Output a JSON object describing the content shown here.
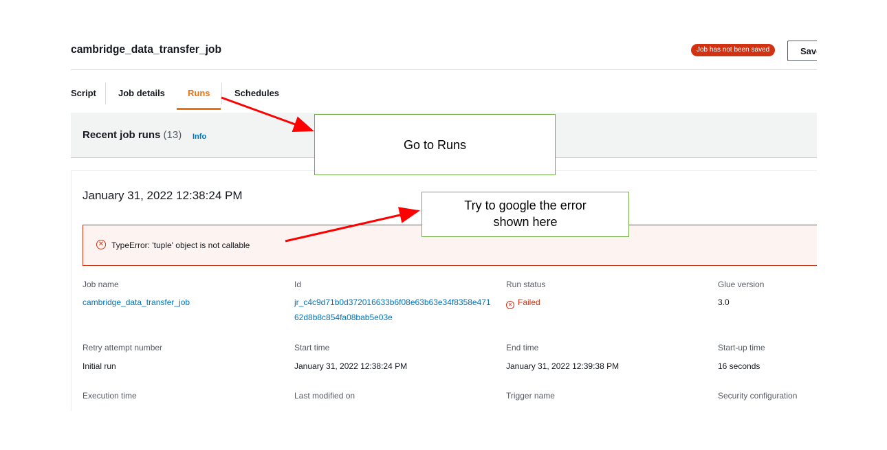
{
  "header": {
    "job_title": "cambridge_data_transfer_job",
    "unsaved_badge": "Job has not been saved",
    "save_label": "Save"
  },
  "tabs": [
    {
      "label": "Script"
    },
    {
      "label": "Job details"
    },
    {
      "label": "Runs",
      "active": true
    },
    {
      "label": "Schedules"
    }
  ],
  "recent_runs": {
    "title": "Recent job runs",
    "count": "(13)",
    "info_link": "Info"
  },
  "run": {
    "date": "January 31, 2022 12:38:24 PM",
    "error_message": "TypeError: 'tuple' object is not callable",
    "fields": {
      "job_name": {
        "label": "Job name",
        "value": "cambridge_data_transfer_job"
      },
      "id": {
        "label": "Id",
        "value": "jr_c4c9d71b0d372016633b6f08e63b63e34f8358e47162d8b8c854fa08bab5e03e"
      },
      "run_status": {
        "label": "Run status",
        "value": "Failed"
      },
      "glue_version": {
        "label": "Glue version",
        "value": "3.0"
      },
      "retry_attempt": {
        "label": "Retry attempt number",
        "value": "Initial run"
      },
      "start_time": {
        "label": "Start time",
        "value": "January 31, 2022 12:38:24 PM"
      },
      "end_time": {
        "label": "End time",
        "value": "January 31, 2022 12:39:38 PM"
      },
      "startup_time": {
        "label": "Start-up time",
        "value": "16 seconds"
      },
      "execution_time": {
        "label": "Execution time"
      },
      "last_modified": {
        "label": "Last modified on"
      },
      "trigger_name": {
        "label": "Trigger name"
      },
      "security_config": {
        "label": "Security configuration"
      }
    }
  },
  "annotations": {
    "go_to_runs": "Go to Runs",
    "google_error_line1": "Try to google the error",
    "google_error_line2": "shown here"
  },
  "colors": {
    "accent_orange": "#ec7211",
    "error_red": "#d13212",
    "link_blue": "#0073bb",
    "annotation_border": "#70ad47",
    "arrow_red": "#ff0000"
  }
}
